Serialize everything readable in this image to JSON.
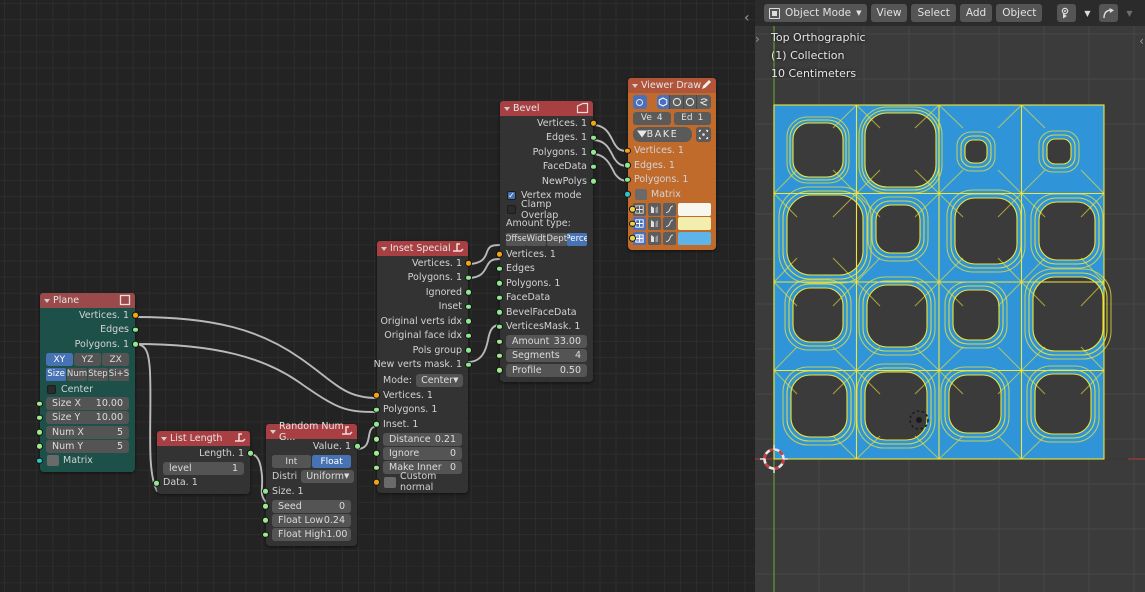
{
  "app": {
    "editors": [
      "node-editor",
      "3d-viewport"
    ]
  },
  "node_editor": {
    "background_color": "#232323",
    "nodes": [
      {
        "id": "plane",
        "title": "Plane",
        "header_color": "#9a4a4a",
        "body_color": "#1d5049",
        "header_icon": "square-outline-icon",
        "outputs": [
          {
            "label": "Vertices. 1",
            "socket": "vertices"
          },
          {
            "label": "Edges",
            "socket": "geometry"
          },
          {
            "label": "Polygons. 1",
            "socket": "geometry"
          }
        ],
        "axis_buttons": {
          "options": [
            "XY",
            "YZ",
            "ZX"
          ],
          "active": "XY"
        },
        "mode_buttons": {
          "options": [
            "Size",
            "Num",
            "Step",
            "Si+S"
          ],
          "active": "Size"
        },
        "center_checkbox": {
          "label": "Center",
          "checked": false
        },
        "fields": [
          {
            "name": "Size X",
            "value": "10.00"
          },
          {
            "name": "Size Y",
            "value": "10.00"
          },
          {
            "name": "Num X",
            "value": "5"
          },
          {
            "name": "Num Y",
            "value": "5"
          }
        ],
        "matrix_input": {
          "label": "Matrix",
          "socket": "matrix"
        }
      },
      {
        "id": "list-length",
        "title": "List Length",
        "header_color": "#a83f42",
        "body_color": "#333333",
        "header_icon": "sverchok-icon",
        "outputs": [
          {
            "label": "Length. 1",
            "socket": "geometry"
          }
        ],
        "fields": [
          {
            "name": "level",
            "value": "1"
          }
        ],
        "inputs": [
          {
            "label": "Data. 1",
            "socket": "geometry"
          }
        ]
      },
      {
        "id": "random-num-gen",
        "title": "Random Num G...",
        "header_color": "#a83f42",
        "body_color": "#333333",
        "header_icon": "sverchok-icon",
        "outputs": [
          {
            "label": "Value. 1",
            "socket": "geometry"
          }
        ],
        "type_buttons": {
          "options": [
            "Int",
            "Float"
          ],
          "active": "Float"
        },
        "distribution": {
          "label": "Distri",
          "value": "Uniform"
        },
        "inputs": [
          {
            "label": "Size. 1",
            "socket": "geometry"
          }
        ],
        "fields": [
          {
            "name": "Seed",
            "value": "0"
          },
          {
            "name": "Float Low",
            "value": "0.24"
          },
          {
            "name": "Float High",
            "value": "1.00"
          }
        ]
      },
      {
        "id": "inset-special",
        "title": "Inset Special",
        "header_color": "#a83f42",
        "body_color": "#333333",
        "header_icon": "sverchok-icon",
        "outputs": [
          {
            "label": "Vertices. 1",
            "socket": "vertices"
          },
          {
            "label": "Polygons. 1",
            "socket": "geometry"
          },
          {
            "label": "Ignored",
            "socket": "geometry"
          },
          {
            "label": "Inset",
            "socket": "geometry"
          },
          {
            "label": "Original verts idx",
            "socket": "geometry"
          },
          {
            "label": "Original face idx",
            "socket": "geometry"
          },
          {
            "label": "Pols group",
            "socket": "geometry"
          },
          {
            "label": "New verts mask. 1",
            "socket": "geometry"
          }
        ],
        "mode": {
          "label": "Mode:",
          "value": "Center"
        },
        "inputs": [
          {
            "label": "Vertices. 1",
            "socket": "vertices"
          },
          {
            "label": "Polygons. 1",
            "socket": "geometry"
          },
          {
            "label": "Inset. 1",
            "socket": "geometry"
          }
        ],
        "fields": [
          {
            "name": "Distance",
            "value": "0.21"
          },
          {
            "name": "Ignore",
            "value": "0"
          },
          {
            "name": "Make Inner",
            "value": "0"
          }
        ],
        "custom_normal": {
          "label": "Custom normal",
          "socket": "vertices"
        }
      },
      {
        "id": "bevel",
        "title": "Bevel",
        "header_color": "#a83f42",
        "body_color": "#333333",
        "header_icon": "bevel-shape-icon",
        "outputs": [
          {
            "label": "Vertices. 1",
            "socket": "vertices"
          },
          {
            "label": "Edges. 1",
            "socket": "geometry"
          },
          {
            "label": "Polygons. 1",
            "socket": "geometry"
          },
          {
            "label": "FaceData",
            "socket": "geometry"
          },
          {
            "label": "NewPolys",
            "socket": "geometry"
          }
        ],
        "vertex_mode": {
          "label": "Vertex mode",
          "checked": true
        },
        "clamp_overlap": {
          "label": "Clamp Overlap",
          "checked": false
        },
        "amount_type_label": "Amount type:",
        "amount_type": {
          "options": [
            "Offse",
            "Widt",
            "Dept",
            "Perce"
          ],
          "active": "Perce"
        },
        "inputs": [
          {
            "label": "Vertices. 1",
            "socket": "vertices"
          },
          {
            "label": "Edges",
            "socket": "geometry"
          },
          {
            "label": "Polygons. 1",
            "socket": "geometry"
          },
          {
            "label": "FaceData",
            "socket": "geometry"
          },
          {
            "label": "BevelFaceData",
            "socket": "geometry"
          },
          {
            "label": "VerticesMask. 1",
            "socket": "geometry"
          }
        ],
        "fields": [
          {
            "name": "Amount",
            "value": "33.00"
          },
          {
            "name": "Segments",
            "value": "4"
          },
          {
            "name": "Profile",
            "value": "0.50"
          }
        ]
      },
      {
        "id": "viewer-draw",
        "title": "Viewer Draw",
        "header_color": "#b0553a",
        "body_color": "#c06a2c",
        "header_icon": "pencil-icon",
        "eye_icon": "eye-icon",
        "display_toggles": {
          "options": [
            "verts-icon",
            "circle-icon",
            "circle-icon",
            "loop-icon"
          ],
          "active_index": 0
        },
        "counts": [
          {
            "label": "Ve",
            "value": "4"
          },
          {
            "label": "Ed",
            "value": "1"
          }
        ],
        "bake_button": {
          "label": "BAKE",
          "icon": "triangle-down-icon"
        },
        "bake_extra_icon": "bracket-icon",
        "inputs": [
          {
            "label": "Vertices. 1",
            "socket": "vertices"
          },
          {
            "label": "Edges. 1",
            "socket": "geometry"
          },
          {
            "label": "Polygons. 1",
            "socket": "geometry"
          },
          {
            "label": "Matrix",
            "socket": "matrix"
          }
        ],
        "color_rows": [
          {
            "swatch": "#f7f7f0",
            "icons": [
              "grid-icon",
              "shade-icon",
              "curve-icon"
            ],
            "active": false
          },
          {
            "swatch": "#f2eeae",
            "icons": [
              "grid-icon",
              "shade-icon",
              "curve-icon"
            ],
            "active": true
          },
          {
            "swatch": "#5cb4e8",
            "icons": [
              "grid-icon",
              "shade-icon",
              "curve-icon"
            ],
            "active": true
          }
        ]
      }
    ],
    "links": [
      {
        "from": "plane.Vertices.1",
        "to": "inset-special.Vertices.1"
      },
      {
        "from": "plane.Polygons.1",
        "to": "inset-special.Polygons.1"
      },
      {
        "from": "plane.Polygons.1",
        "to": "list-length.Data.1"
      },
      {
        "from": "list-length.Length.1",
        "to": "random-num-gen.Size.1"
      },
      {
        "from": "random-num-gen.Value.1",
        "to": "inset-special.Inset.1"
      },
      {
        "from": "inset-special.Vertices.1",
        "to": "bevel.Vertices.1"
      },
      {
        "from": "inset-special.Polygons.1",
        "to": "bevel.Polygons.1"
      },
      {
        "from": "inset-special.New verts mask.1",
        "to": "bevel.VerticesMask.1"
      },
      {
        "from": "bevel.Vertices.1",
        "to": "viewer-draw.Vertices.1"
      },
      {
        "from": "bevel.Edges.1",
        "to": "viewer-draw.Edges.1"
      },
      {
        "from": "bevel.Polygons.1",
        "to": "viewer-draw.Polygons.1"
      }
    ]
  },
  "viewport": {
    "header": {
      "mode": "Object Mode",
      "menus": [
        "View",
        "Select",
        "Add",
        "Object"
      ],
      "right_icons": [
        "visibility-icon",
        "chevron-down-icon",
        "snap-icon",
        "chevron-down-icon"
      ]
    },
    "overlay_text": {
      "view_name": "Top Orthographic",
      "collection": "(1) Collection",
      "grid_scale": "10 Centimeters"
    },
    "collapse_left_arrow": "‹",
    "expand_arrow": "›",
    "collapse_right_arrow": "‹",
    "colors": {
      "face": "#2f95d8",
      "edge": "#f2e534",
      "background": "#3b3b3b"
    },
    "mesh": {
      "description": "4x4 grid of inset+beveled plane faces",
      "grid": 4,
      "hole_radii": [
        [
          0.56,
          0.78,
          0.18,
          0.2
        ],
        [
          0.82,
          0.46,
          0.66,
          0.6
        ],
        [
          0.52,
          0.6,
          0.44,
          0.74
        ],
        [
          0.62,
          0.66,
          0.54,
          0.58
        ]
      ]
    },
    "cursor_3d": "3d-cursor-icon",
    "object_origin": "object-origin-icon"
  }
}
